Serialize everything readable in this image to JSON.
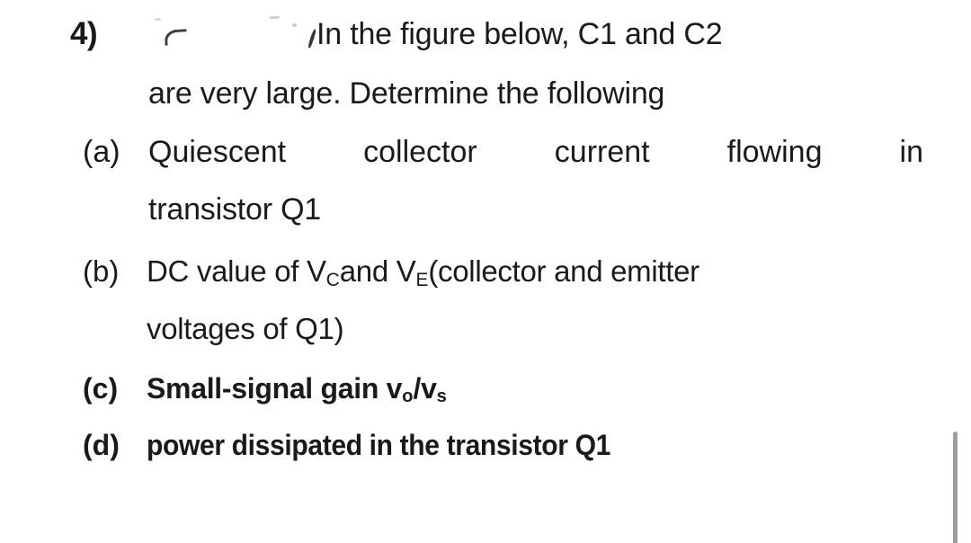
{
  "document": {
    "background_color": "#ffffff",
    "text_color": "#1a1a1a",
    "question_number": "4)",
    "intro_line_1": "In the figure below, C1 and C2",
    "intro_line_2": "are very large. Determine the following",
    "items": [
      {
        "marker": "(a)",
        "line_1": "Quiescent collector current flowing in",
        "line_2": "transistor Q1"
      },
      {
        "marker": "(b)",
        "text_before_vc": "DC value of V",
        "vc_subscript": "C",
        "text_between": " and V",
        "ve_subscript": "E",
        "text_after": " (collector and emitter",
        "line_2": "voltages of Q1)"
      },
      {
        "marker": "(c)",
        "text_before": "Small-signal gain v",
        "vo_subscript": "o",
        "slash": "/v",
        "vs_subscript": "s"
      },
      {
        "marker": "(d)",
        "text": "power dissipated in the transistor Q1"
      }
    ],
    "artifacts": {
      "right_edge_rule_color": "#9e9e9e",
      "smudge_color": "#2c2c2c"
    }
  }
}
